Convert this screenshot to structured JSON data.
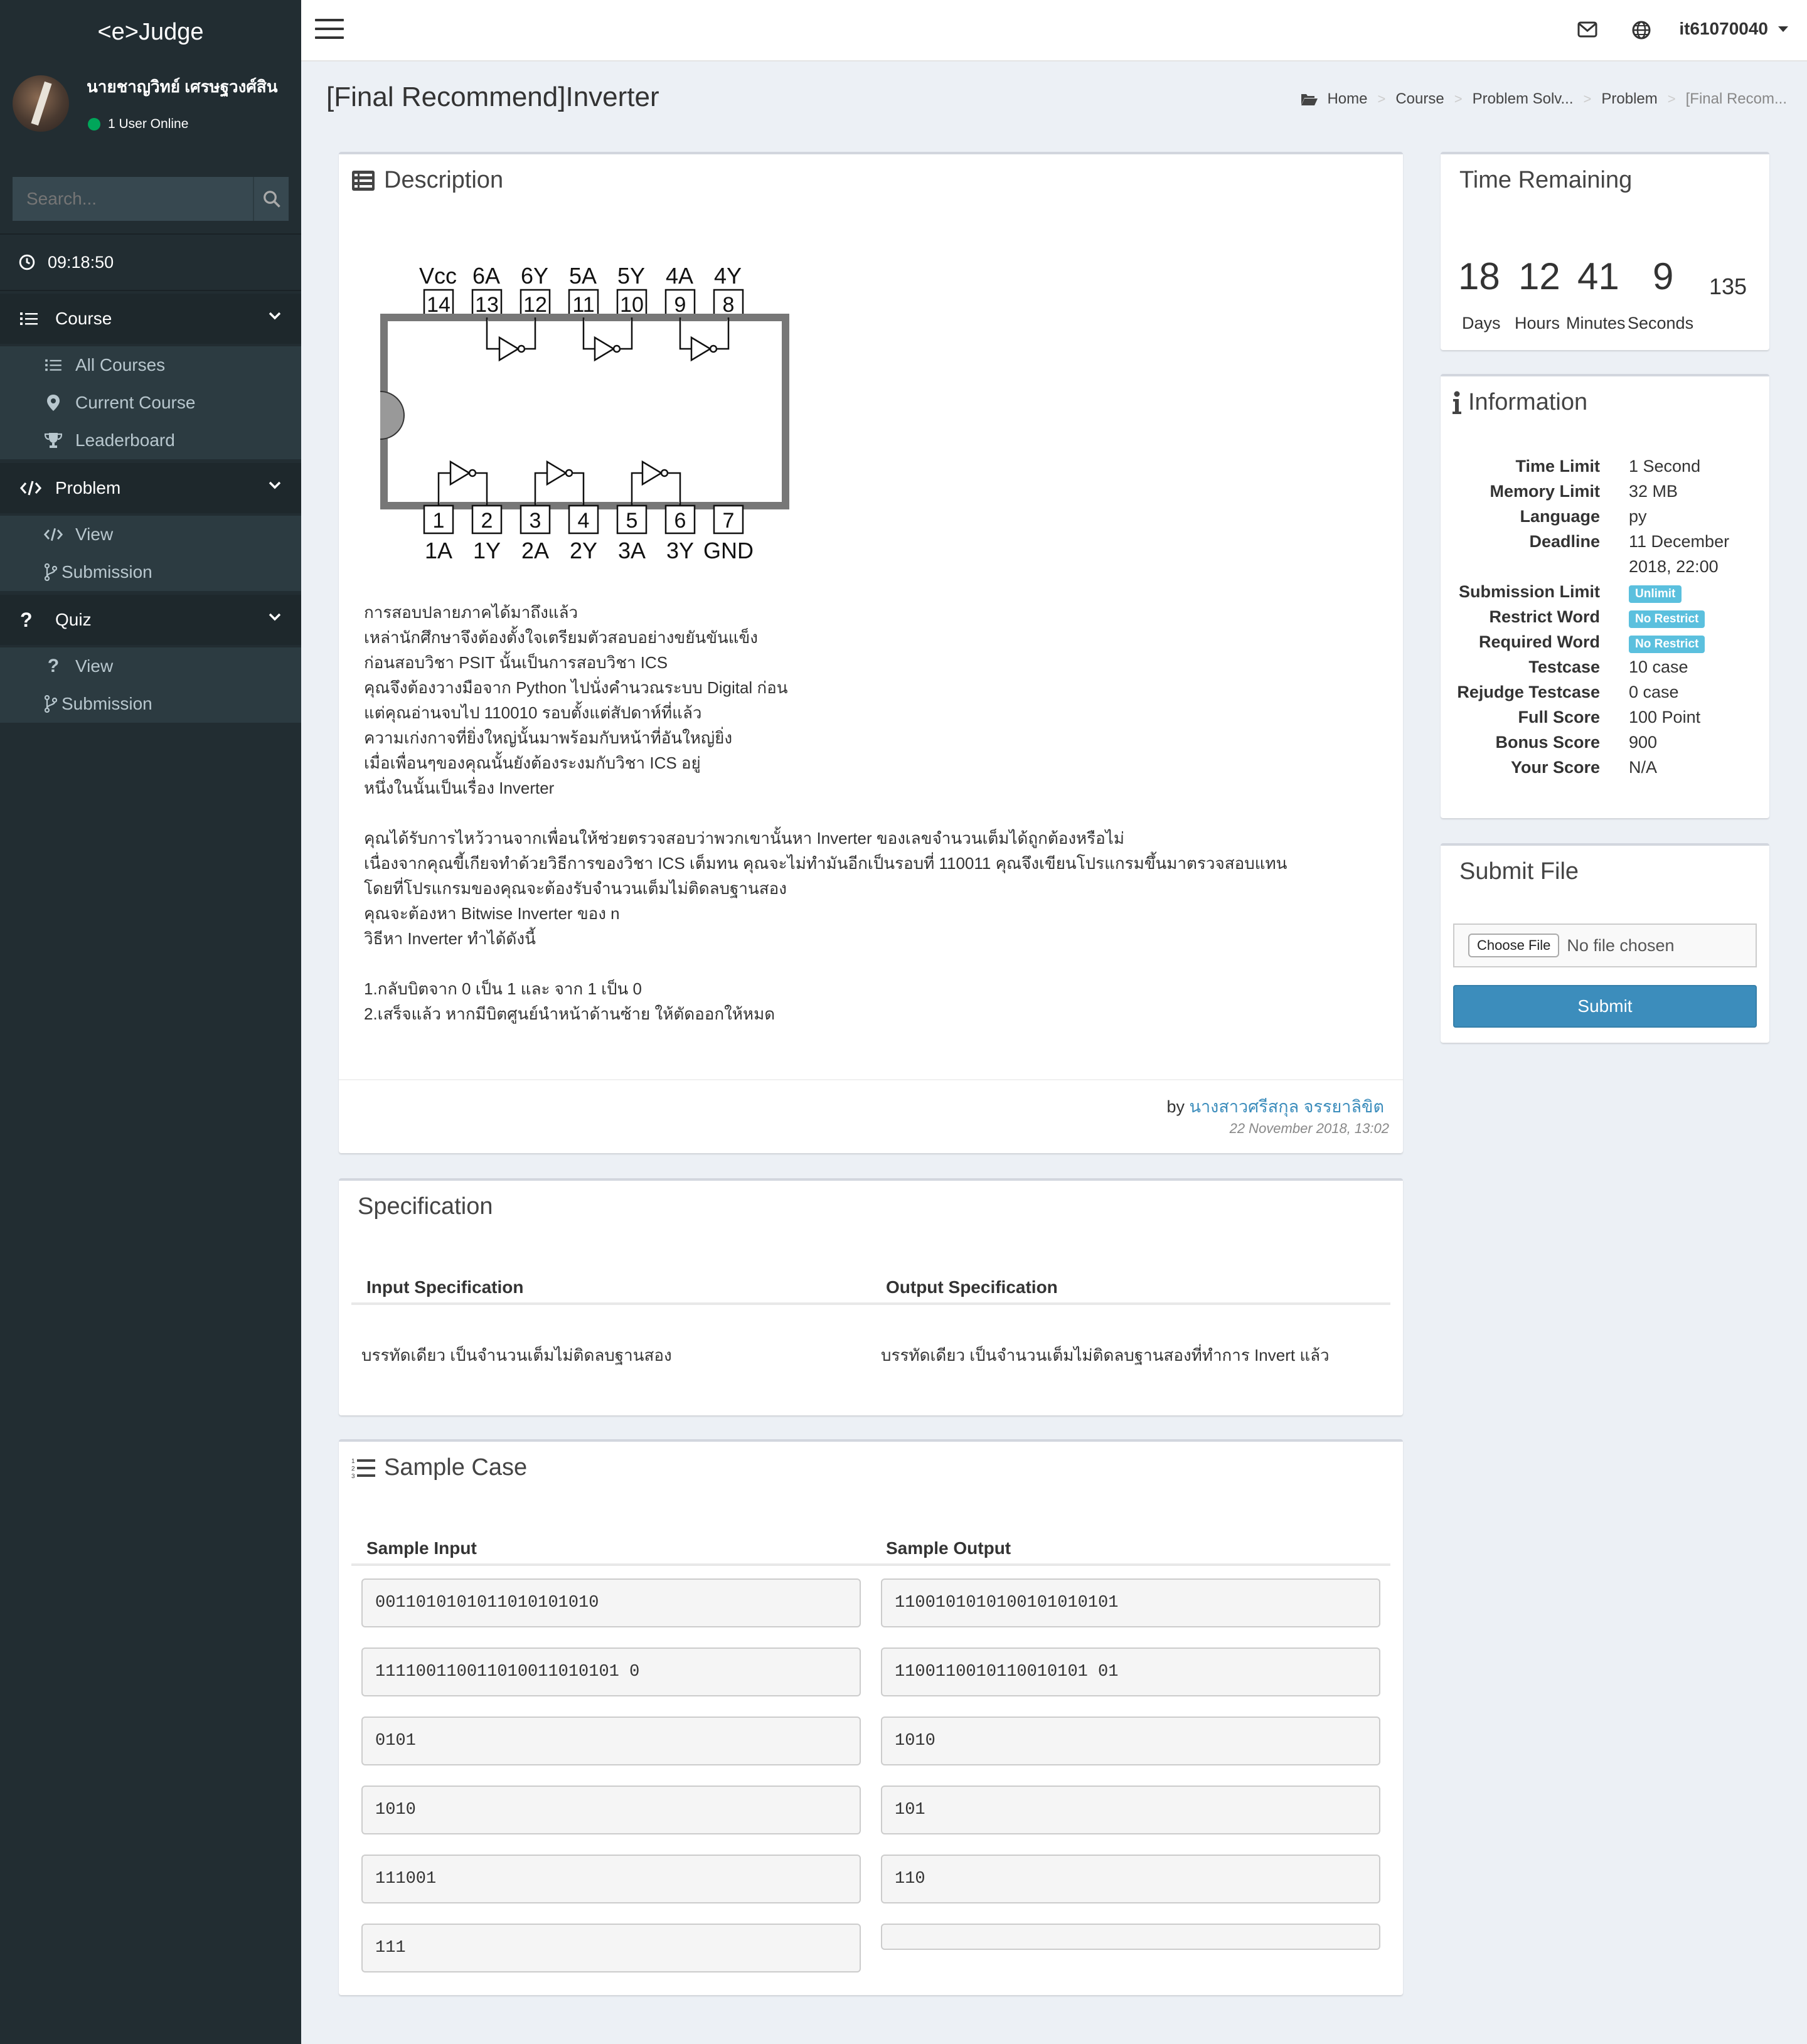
{
  "app": {
    "logo": "<e>Judge"
  },
  "user": {
    "name": "นายชาญวิทย์ เศรษฐวงศ์สิน",
    "online": "1 User Online"
  },
  "search": {
    "placeholder": "Search..."
  },
  "clock": "09:18:50",
  "sidebar": {
    "course": {
      "label": "Course",
      "items": [
        "All Courses",
        "Current Course",
        "Leaderboard"
      ]
    },
    "problem": {
      "label": "Problem",
      "items": [
        "View",
        "Submission"
      ]
    },
    "quiz": {
      "label": "Quiz",
      "items": [
        "View",
        "Submission"
      ]
    }
  },
  "topbar": {
    "username": "it61070040"
  },
  "page": {
    "title": "[Final Recommend]Inverter"
  },
  "breadcrumb": [
    "Home",
    "Course",
    "Problem Solv...",
    "Problem",
    "[Final Recom..."
  ],
  "description": {
    "title": "Description",
    "diagram": {
      "top_labels": [
        "Vcc",
        "6A",
        "6Y",
        "5A",
        "5Y",
        "4A",
        "4Y"
      ],
      "top_pins": [
        "14",
        "13",
        "12",
        "11",
        "10",
        "9",
        "8"
      ],
      "bottom_pins": [
        "1",
        "2",
        "3",
        "4",
        "5",
        "6",
        "7"
      ],
      "bottom_labels": [
        "1A",
        "1Y",
        "2A",
        "2Y",
        "3A",
        "3Y",
        "GND"
      ]
    },
    "paragraph1": [
      "การสอบปลายภาคได้มาถึงแล้ว",
      "เหล่านักศึกษาจึงต้องตั้งใจเตรียมตัวสอบอย่างขยันขันแข็ง",
      "ก่อนสอบวิชา PSIT นั้นเป็นการสอบวิชา ICS",
      "คุณจึงต้องวางมือจาก Python ไปนั่งคำนวณระบบ Digital ก่อน",
      "แต่คุณอ่านจบไป 110010 รอบตั้งแต่สัปดาห์ที่แล้ว",
      "ความเก่งกาจที่ยิ่งใหญ่นั้นมาพร้อมกับหน้าที่อันใหญ่ยิ่ง",
      "เมื่อเพื่อนๆของคุณนั้นยังต้องระงมกับวิชา ICS อยู่",
      "หนึ่งในนั้นเป็นเรื่อง Inverter"
    ],
    "paragraph2": [
      "คุณได้รับการไหว้วานจากเพื่อนให้ช่วยตรวจสอบว่าพวกเขานั้นหา Inverter ของเลขจำนวนเต็มได้ถูกต้องหรือไม่",
      "เนื่องจากคุณขี้เกียจทำด้วยวิธีการของวิชา ICS เต็มทน คุณจะไม่ทำมันอีกเป็นรอบที่ 110011 คุณจึงเขียนโปรแกรมขึ้นมาตรวจสอบแทน",
      "โดยที่โปรแกรมของคุณจะต้องรับจำนวนเต็มไม่ติดลบฐานสอง",
      "คุณจะต้องหา Bitwise Inverter ของ n",
      "วิธีหา Inverter ทำได้ดังนี้"
    ],
    "paragraph3": [
      "1.กลับบิตจาก 0 เป็น 1 และ จาก 1 เป็น 0",
      "2.เสร็จแล้ว หากมีบิตศูนย์นำหน้าด้านซ้าย ให้ตัดออกให้หมด"
    ],
    "by_label": "by",
    "author": "นางสาวศรีสกุล จรรยาลิขิต",
    "posted": "22 November 2018, 13:02"
  },
  "specification": {
    "title": "Specification",
    "input_header": "Input Specification",
    "output_header": "Output Specification",
    "input": "บรรทัดเดียว เป็นจำนวนเต็มไม่ติดลบฐานสอง",
    "output": "บรรทัดเดียว เป็นจำนวนเต็มไม่ติดลบฐานสองที่ทำการ Invert แล้ว"
  },
  "samples": {
    "title": "Sample Case",
    "input_header": "Sample Input",
    "output_header": "Sample Output",
    "rows": [
      {
        "input": "0011010101011010101010",
        "output": "1100101010100101010101"
      },
      {
        "input": "111100110011010011010101 0",
        "output": "1100110010110010101 01"
      },
      {
        "input": "0101",
        "output": "1010"
      },
      {
        "input": "1010",
        "output": "101"
      },
      {
        "input": "111001",
        "output": "110"
      },
      {
        "input": "111",
        "output": ""
      }
    ]
  },
  "timer": {
    "title": "Time Remaining",
    "days": "18",
    "hours": "12",
    "minutes": "41",
    "seconds": "9",
    "ms": "135",
    "days_label": "Days",
    "hours_label": "Hours",
    "minutes_label": "Minutes",
    "seconds_label": "Seconds"
  },
  "info": {
    "title": "Information",
    "rows": [
      {
        "key": "Time Limit",
        "value": "1 Second"
      },
      {
        "key": "Memory Limit",
        "value": "32 MB"
      },
      {
        "key": "Language",
        "value": "py"
      },
      {
        "key": "Deadline",
        "value": "11 December"
      },
      {
        "key": "",
        "value": "2018, 22:00"
      },
      {
        "key": "Submission Limit",
        "badge": "Unlimit"
      },
      {
        "key": "Restrict Word",
        "badge": "No Restrict"
      },
      {
        "key": "Required Word",
        "badge": "No Restrict"
      },
      {
        "key": "Testcase",
        "value": "10 case"
      },
      {
        "key": "Rejudge Testcase",
        "value": "0 case"
      },
      {
        "key": "Full Score",
        "value": "100 Point"
      },
      {
        "key": "Bonus Score",
        "value": "900"
      },
      {
        "key": "Your Score",
        "value": "N/A"
      }
    ]
  },
  "submit": {
    "title": "Submit File",
    "choose_label": "Choose File",
    "no_file": "No file chosen",
    "button": "Submit"
  },
  "colors": {
    "sidebar": "#222d32",
    "accent": "#3c8dbc",
    "badge": "#5bc0de",
    "online": "#00a65a"
  }
}
